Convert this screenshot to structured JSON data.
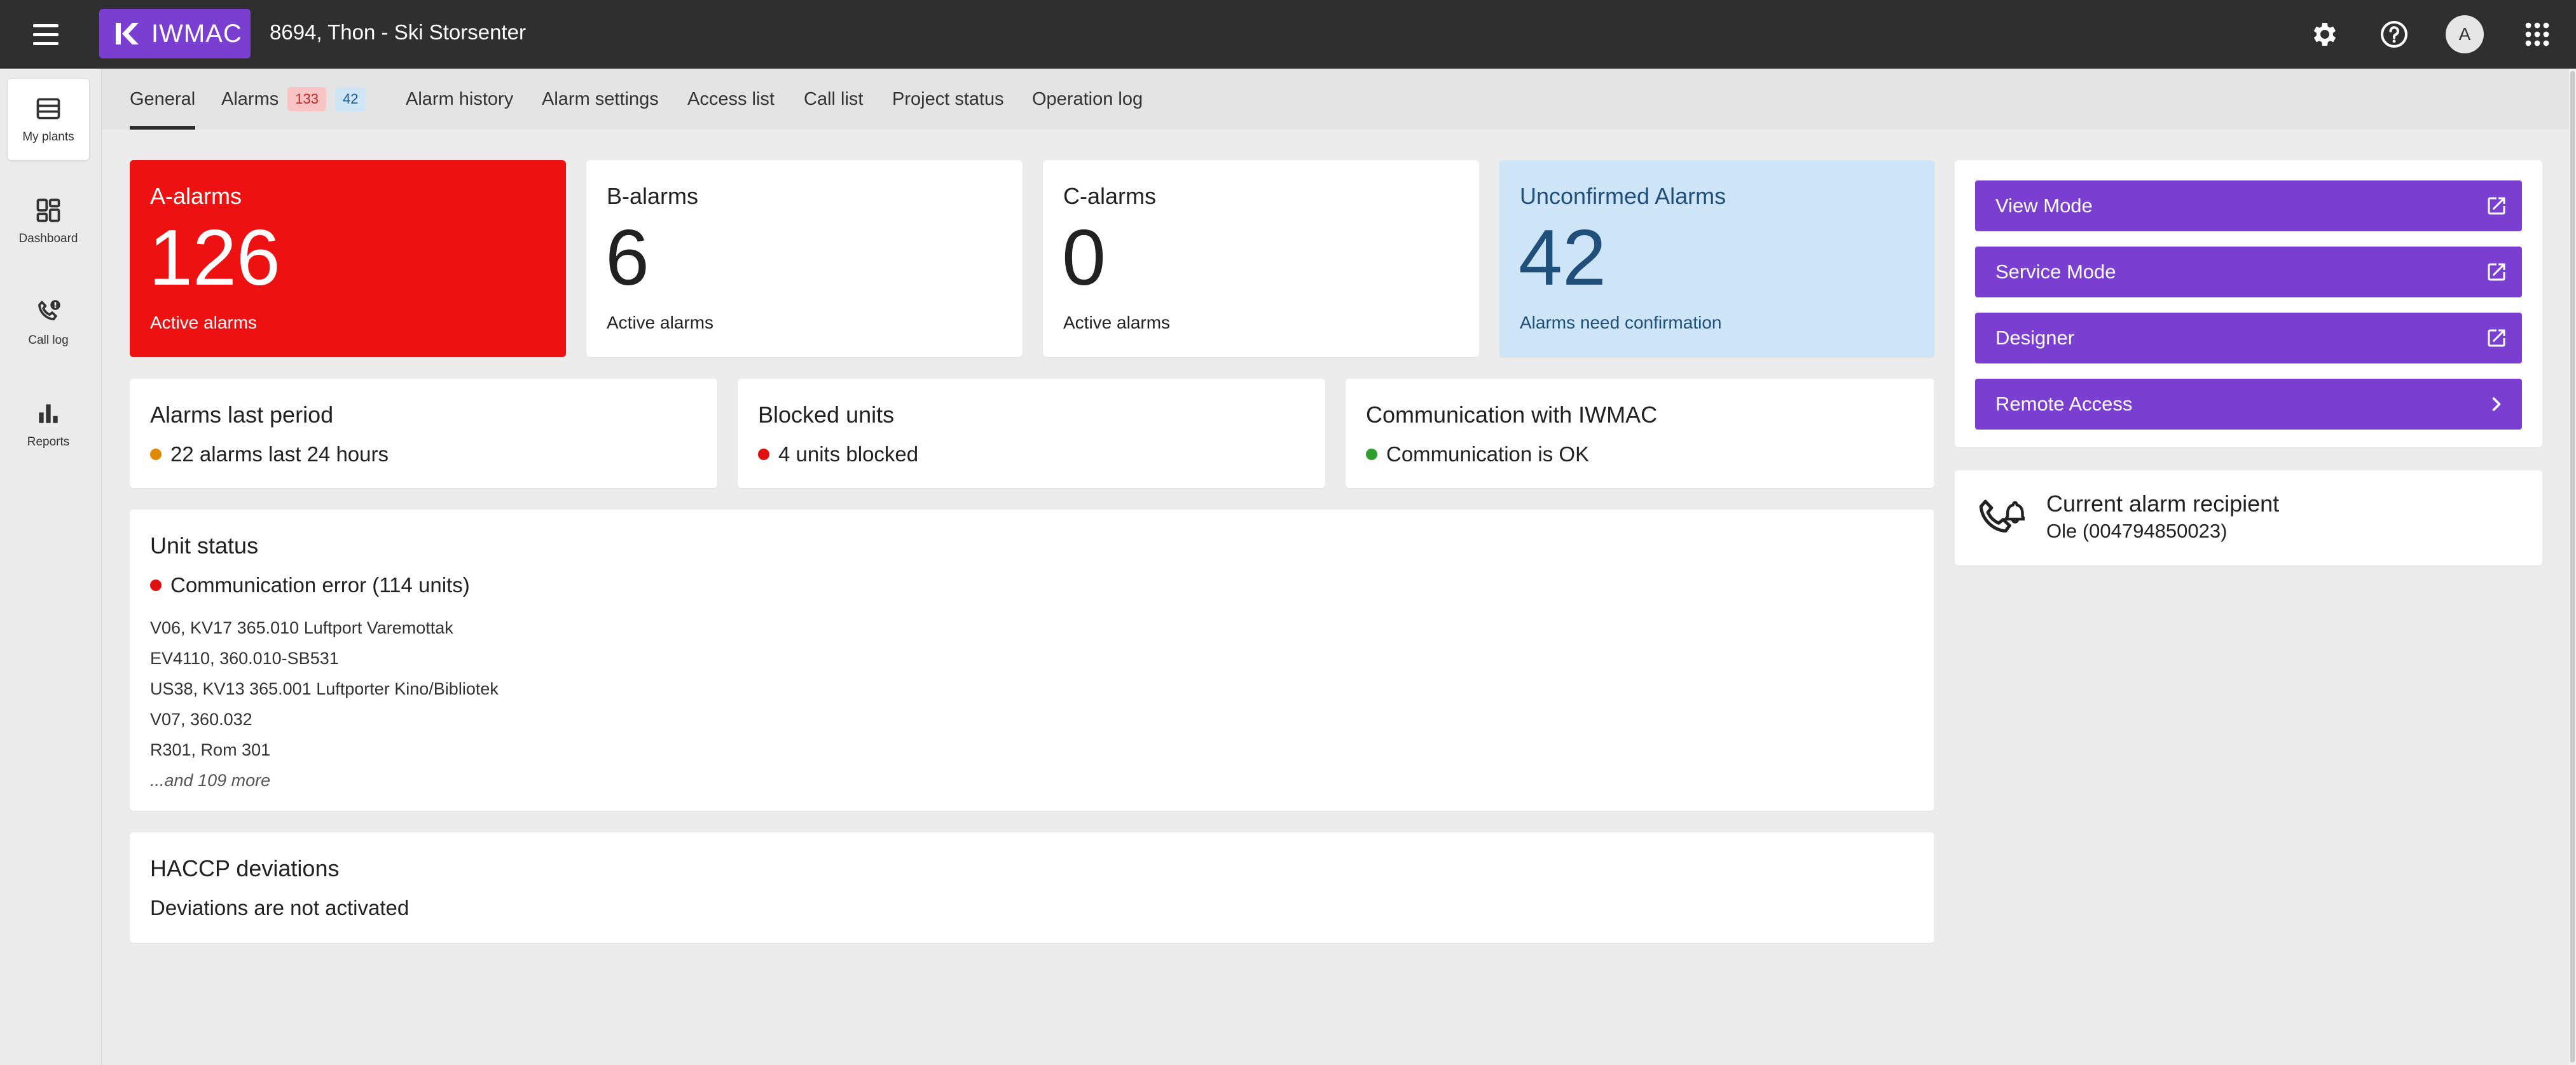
{
  "app": {
    "brand": "IWMAC",
    "site_title": "8694, Thon - Ski Storsenter",
    "avatar_initial": "A",
    "accent_color": "#7a3fd0"
  },
  "leftnav": {
    "items": [
      {
        "label": "My plants",
        "icon": "list-icon"
      },
      {
        "label": "Dashboard",
        "icon": "dashboard-icon"
      },
      {
        "label": "Call log",
        "icon": "phone-alert-icon"
      },
      {
        "label": "Reports",
        "icon": "bar-chart-icon"
      }
    ]
  },
  "tabs": {
    "general": "General",
    "alarms": "Alarms",
    "alarms_badge_red": "133",
    "alarms_badge_blue": "42",
    "alarm_history": "Alarm history",
    "alarm_settings": "Alarm settings",
    "access_list": "Access list",
    "call_list": "Call list",
    "project_status": "Project status",
    "operation_log": "Operation log"
  },
  "kpis": {
    "a": {
      "title": "A-alarms",
      "value": "126",
      "sub": "Active alarms",
      "color": "#ee1111"
    },
    "b": {
      "title": "B-alarms",
      "value": "6",
      "sub": "Active alarms"
    },
    "c": {
      "title": "C-alarms",
      "value": "0",
      "sub": "Active alarms"
    },
    "unconfirmed": {
      "title": "Unconfirmed Alarms",
      "value": "42",
      "sub": "Alarms need confirmation",
      "color": "#cde5f6"
    }
  },
  "stats": {
    "last_period": {
      "title": "Alarms last period",
      "text": "22 alarms last 24 hours",
      "dot_color": "#e08a00"
    },
    "blocked": {
      "title": "Blocked units",
      "text": "4 units blocked",
      "dot_color": "#e01010"
    },
    "communication": {
      "title": "Communication with IWMAC",
      "text": "Communication is OK",
      "dot_color": "#2e9e2e"
    }
  },
  "unit_status": {
    "title": "Unit status",
    "summary": "Communication error (114 units)",
    "dot_color": "#e01010",
    "units": [
      "V06, KV17 365.010 Luftport Varemottak",
      "EV4110, 360.010-SB531",
      "US38, KV13 365.001 Luftporter Kino/Bibliotek",
      "V07, 360.032",
      "R301, Rom 301"
    ],
    "more": "...and 109 more"
  },
  "haccp": {
    "title": "HACCP deviations",
    "text": "Deviations are not activated"
  },
  "actions": {
    "view_mode": "View Mode",
    "service_mode": "Service Mode",
    "designer": "Designer",
    "remote_access": "Remote Access"
  },
  "recipient": {
    "title": "Current alarm recipient",
    "name": "Ole (004794850023)"
  }
}
